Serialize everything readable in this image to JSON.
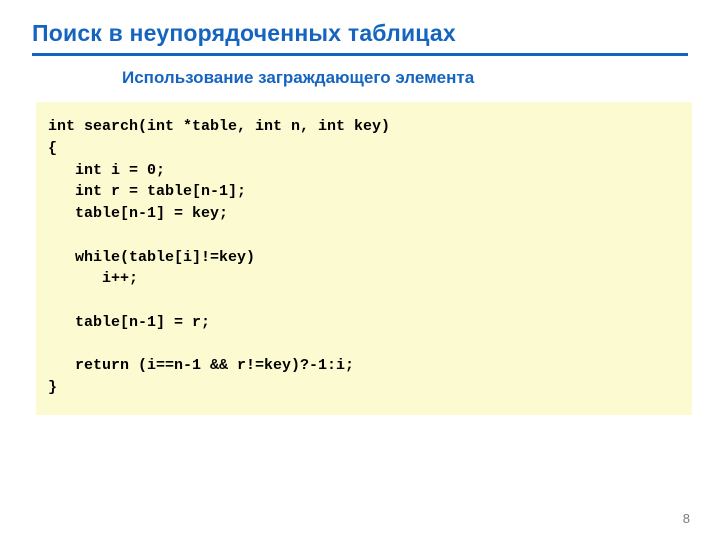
{
  "slide": {
    "title": "Поиск в неупорядоченных таблицах",
    "subtitle": "Использование заграждающего элемента",
    "code": "int search(int *table, int n, int key)\n{\n   int i = 0;\n   int r = table[n-1];\n   table[n-1] = key;\n\n   while(table[i]!=key)\n      i++;\n\n   table[n-1] = r;\n\n   return (i==n-1 && r!=key)?-1:i;\n}",
    "page_number": "8"
  }
}
